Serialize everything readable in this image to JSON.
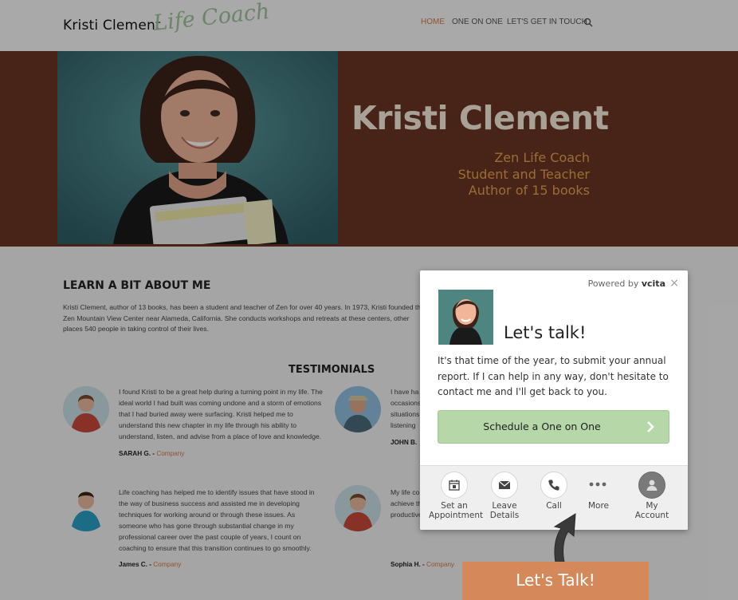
{
  "header": {
    "logo_name": "Kristi Clement",
    "logo_sub": "Life Coach",
    "nav": [
      {
        "label": "HOME",
        "active": true
      },
      {
        "label": "ONE ON ONE",
        "active": false
      },
      {
        "label": "LET'S GET IN TOUCH",
        "active": false
      }
    ],
    "search_icon": "search-icon"
  },
  "hero": {
    "title": "Kristi Clement",
    "lines": [
      "Zen Life Coach",
      "Student and Teacher",
      "Author of 15 books"
    ]
  },
  "about": {
    "title": "LEARN A BIT ABOUT ME",
    "text": "Kristi Clement, author of 13 books, has been a student and teacher of Zen for over 40 years. In 1973, Kristi founded the Zen Mountain View Center near Alameda, California. She conducts workshops and retreats at these centers, other places 540 people in taking control of their lives."
  },
  "testimonials": {
    "title": "TESTIMONIALS",
    "items": [
      {
        "text": "I found Kristi to be a great help during a turning point in my life. The ideal world I had built was coming undone and a storm of emotions that I had buried away were surfacing. Kristi helped me to understand this new chapter in my life through his ability to understand, listen, and advise from a place of love and knowledge.",
        "author": "SARAH G.",
        "company": "Company"
      },
      {
        "text": "I have ha occasions situations listening",
        "author": "JOHN B.",
        "company": ""
      },
      {
        "text": "Life coaching has helped me to identify issues that have stood in the way of business success and assisted me in developing techniques for working around or through these issues. As someone who has gone through substantial change in my professional career over the past couple of years, I count on coaching to ensure that this transition continues to go smoothly.",
        "author": "James C.",
        "company": "Company"
      },
      {
        "text": "My life co achieve go who I am She has t allow me to achieve those goals. My sessions with Kristi always productive.",
        "author": "Sophia H.",
        "company": "Company"
      }
    ],
    "separator": " - "
  },
  "widget": {
    "powered_prefix": "Powered by",
    "powered_brand": "vcita",
    "close": "×",
    "title": "Let's talk!",
    "text": "It's that time of the year, to submit your annual report. If I can help in any way, don't hesitate to contact me and I'll get back to you.",
    "schedule_label": "Schedule a One on One",
    "actions": [
      {
        "label1": "Set an",
        "label2": "Appointment",
        "icon": "calendar-icon"
      },
      {
        "label1": "Leave",
        "label2": "Details",
        "icon": "envelope-icon"
      },
      {
        "label1": "Call",
        "label2": "",
        "icon": "phone-icon"
      },
      {
        "label1": "More",
        "label2": "",
        "icon": "more-dots-icon"
      },
      {
        "label1": "My",
        "label2": "Account",
        "icon": "account-icon"
      }
    ]
  },
  "talk_tab": {
    "label": "Let's Talk!"
  },
  "colors": {
    "hero_bg": "#6a3423",
    "accent": "#d47b44",
    "hero_title": "#f6efdc",
    "hero_lines": "#e5a24f",
    "schedule_btn": "#b6d7a8",
    "talk_tab": "#d5885a"
  }
}
